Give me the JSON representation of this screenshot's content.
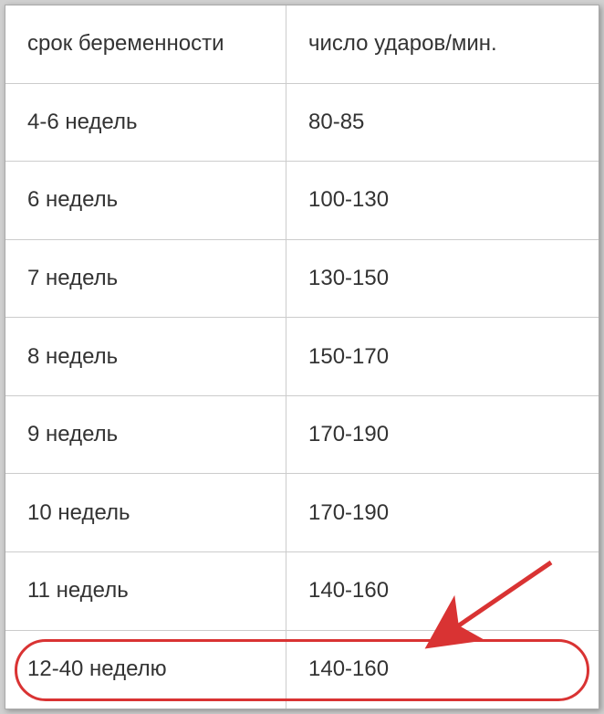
{
  "table": {
    "headers": {
      "gestational_age": "срок беременности",
      "beats_per_min": "число ударов/мин."
    },
    "rows": [
      {
        "age": "4-6 недель",
        "bpm": "80-85"
      },
      {
        "age": "6 недель",
        "bpm": "100-130"
      },
      {
        "age": "7 недель",
        "bpm": "130-150"
      },
      {
        "age": "8 недель",
        "bpm": "150-170"
      },
      {
        "age": "9 недель",
        "bpm": "170-190"
      },
      {
        "age": "10 недель",
        "bpm": "170-190"
      },
      {
        "age": "11 недель",
        "bpm": "140-160"
      },
      {
        "age": "12-40 неделю",
        "bpm": "140-160"
      }
    ]
  },
  "highlight": {
    "row_index": 7,
    "color": "#d93333"
  }
}
